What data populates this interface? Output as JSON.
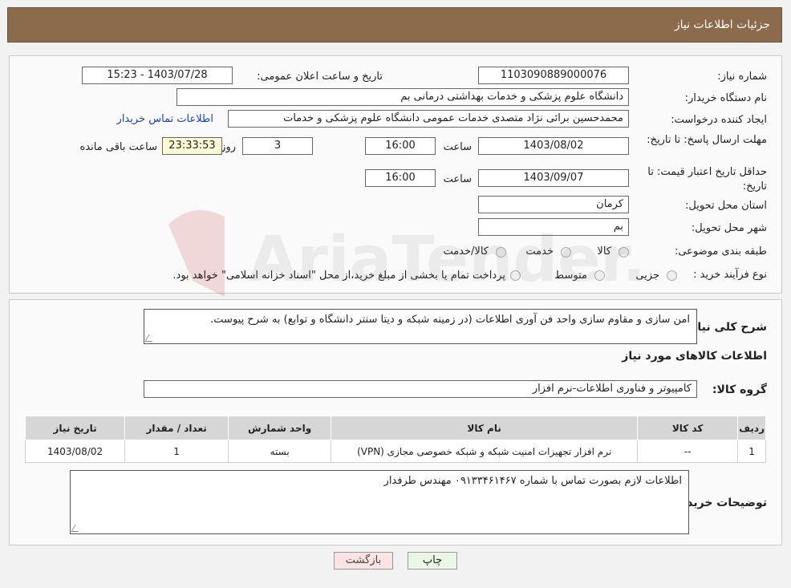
{
  "page_title": "جزئیات اطلاعات نیاز",
  "watermark_text": "AriaTender.neT",
  "fields": {
    "need_number_label": "شماره نیاز:",
    "need_number": "1103090889000076",
    "announce_label": "تاریخ و ساعت اعلان عمومی:",
    "announce_value": "1403/07/28 - 15:23",
    "buyer_org_label": "نام دستگاه خریدار:",
    "buyer_org": "دانشگاه علوم پزشکی و خدمات بهداشتی  درمانی بم",
    "creator_label": "ایجاد کننده درخواست:",
    "creator": "محمدحسین برائی نژاد متصدی خدمات عمومی دانشگاه علوم پزشکی و خدمات",
    "contact_link": "اطلاعات تماس خریدار",
    "deadline_label": "مهلت ارسال پاسخ: تا تاریخ:",
    "deadline_date": "1403/08/02",
    "time_label": "ساعت",
    "deadline_time": "16:00",
    "days": "3",
    "days_label": "روز و",
    "remaining": "23:33:53",
    "remaining_label": "ساعت باقی مانده",
    "validity_label": "حداقل تاریخ اعتبار قیمت: تا تاریخ:",
    "validity_date": "1403/09/07",
    "validity_time": "16:00",
    "province_label": "استان محل تحویل:",
    "province": "کرمان",
    "city_label": "شهر محل تحویل:",
    "city": "بم",
    "category_label": "طبقه بندی موضوعی:",
    "category_options": [
      "کالا",
      "خدمت",
      "کالا/خدمت"
    ],
    "process_label": "نوع فرآیند خرید :",
    "process_options": [
      "جزیی",
      "متوسط"
    ],
    "process_note": "پرداخت تمام یا بخشی از مبلغ خرید،از محل \"اسناد خزانه اسلامی\" خواهد بود."
  },
  "summary": {
    "label": "شرح کلی نیاز:",
    "text": "امن سازی و مقاوم سازی  واحد فن آوری اطلاعات (در زمینه شبکه و دیتا سنتر دانشگاه و توابع) به شرح پیوست."
  },
  "goods_section_title": "اطلاعات کالاهای مورد نیاز",
  "goods_group_label": "گروه کالا:",
  "goods_group": "کامپیوتر و فناوری اطلاعات-نرم افزار",
  "table": {
    "headers": [
      "ردیف",
      "کد کالا",
      "نام کالا",
      "واحد شمارش",
      "تعداد / مقدار",
      "تاریخ نیاز"
    ],
    "rows": [
      [
        "1",
        "--",
        "نرم افزار تجهیزات امنیت شبکه و شبکه خصوصی مجازی (VPN)",
        "بسته",
        "1",
        "1403/08/02"
      ]
    ]
  },
  "buyer_notes_label": "توضیحات خریدار:",
  "buyer_notes": "اطلاعات لازم بصورت تماس با شماره ۰۹۱۳۳۴۶۱۴۶۷ مهندس طرفدار",
  "buttons": {
    "print": "چاپ",
    "back": "بازگشت"
  }
}
